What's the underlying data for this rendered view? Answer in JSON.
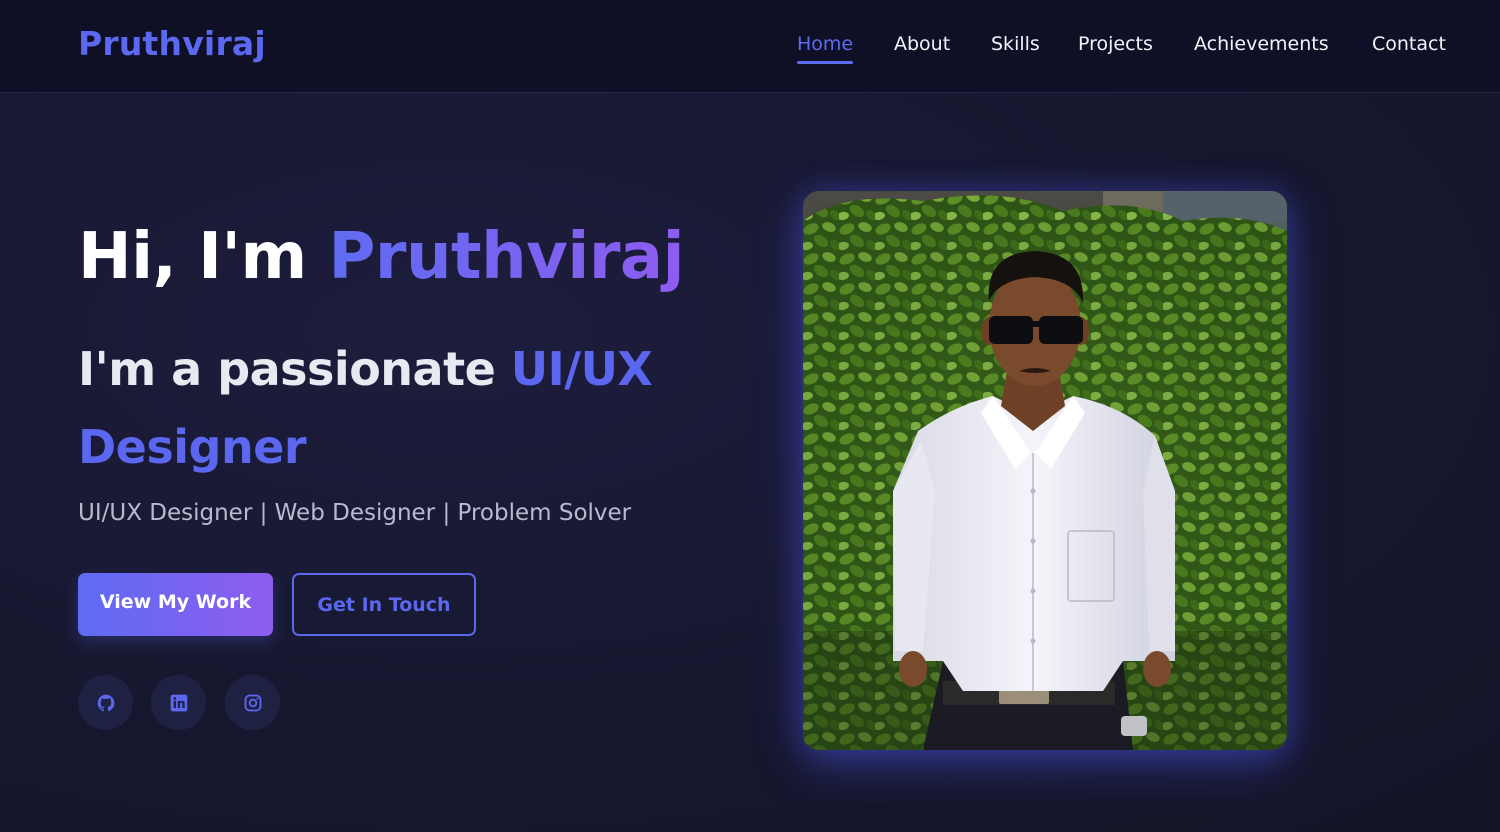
{
  "navbar": {
    "logo": "Pruthviraj",
    "links": [
      {
        "label": "Home",
        "active": true
      },
      {
        "label": "About",
        "active": false
      },
      {
        "label": "Skills",
        "active": false
      },
      {
        "label": "Projects",
        "active": false
      },
      {
        "label": "Achievements",
        "active": false
      },
      {
        "label": "Contact",
        "active": false
      }
    ]
  },
  "hero": {
    "greeting": "Hi, I'm ",
    "name": "Pruthviraj",
    "intro": "I'm a passionate ",
    "role": "UI/UX Designer",
    "tagline": "UI/UX Designer | Web Designer | Problem Solver",
    "primary_button": "View My Work",
    "secondary_button": "Get In Touch"
  },
  "social": [
    {
      "name": "github-icon"
    },
    {
      "name": "linkedin-icon"
    },
    {
      "name": "instagram-icon"
    }
  ],
  "colors": {
    "accent": "#5b68ef",
    "accent_purple": "#8e5cf0",
    "background": "#17182f",
    "navbar_bg": "#0f1026"
  }
}
